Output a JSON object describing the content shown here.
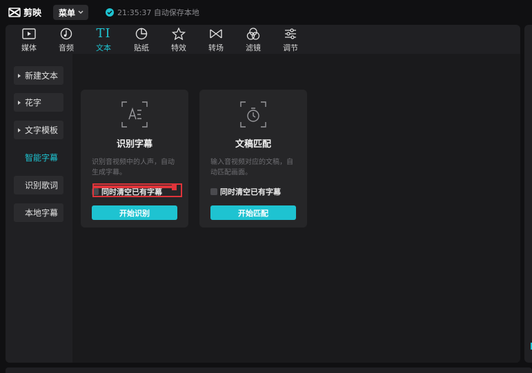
{
  "app": {
    "logo_text": "剪映",
    "menu_label": "菜单",
    "save_status": "21:35:37 自动保存本地"
  },
  "tabs": [
    {
      "label": "媒体",
      "icon": "media-icon"
    },
    {
      "label": "音频",
      "icon": "audio-icon"
    },
    {
      "label": "文本",
      "icon": "text-icon",
      "glyph": "TI",
      "active": true
    },
    {
      "label": "贴纸",
      "icon": "sticker-icon"
    },
    {
      "label": "特效",
      "icon": "effects-icon"
    },
    {
      "label": "转场",
      "icon": "transition-icon"
    },
    {
      "label": "滤镜",
      "icon": "filter-icon"
    },
    {
      "label": "调节",
      "icon": "adjust-icon"
    }
  ],
  "sidebar": {
    "items": [
      {
        "label": "新建文本",
        "expandable": true
      },
      {
        "label": "花字",
        "expandable": true
      },
      {
        "label": "文字模板",
        "expandable": true
      },
      {
        "label": "智能字幕",
        "active": true
      },
      {
        "label": "识别歌词"
      },
      {
        "label": "本地字幕"
      }
    ]
  },
  "cards": [
    {
      "title": "识别字幕",
      "icon": "speech-recognition-icon",
      "description": "识别音视频中的人声，自动生成字幕。",
      "option_label": "同时清空已有字幕",
      "button_label": "开始识别"
    },
    {
      "title": "文稿匹配",
      "icon": "text-match-icon",
      "description": "输入音视频对应的文稿，自动匹配画面。",
      "option_label": "同时清空已有字幕",
      "button_label": "开始匹配"
    }
  ],
  "colors": {
    "accent": "#1ec3d1",
    "annotation": "#e0343a",
    "panel": "#202023",
    "background": "#101012"
  }
}
